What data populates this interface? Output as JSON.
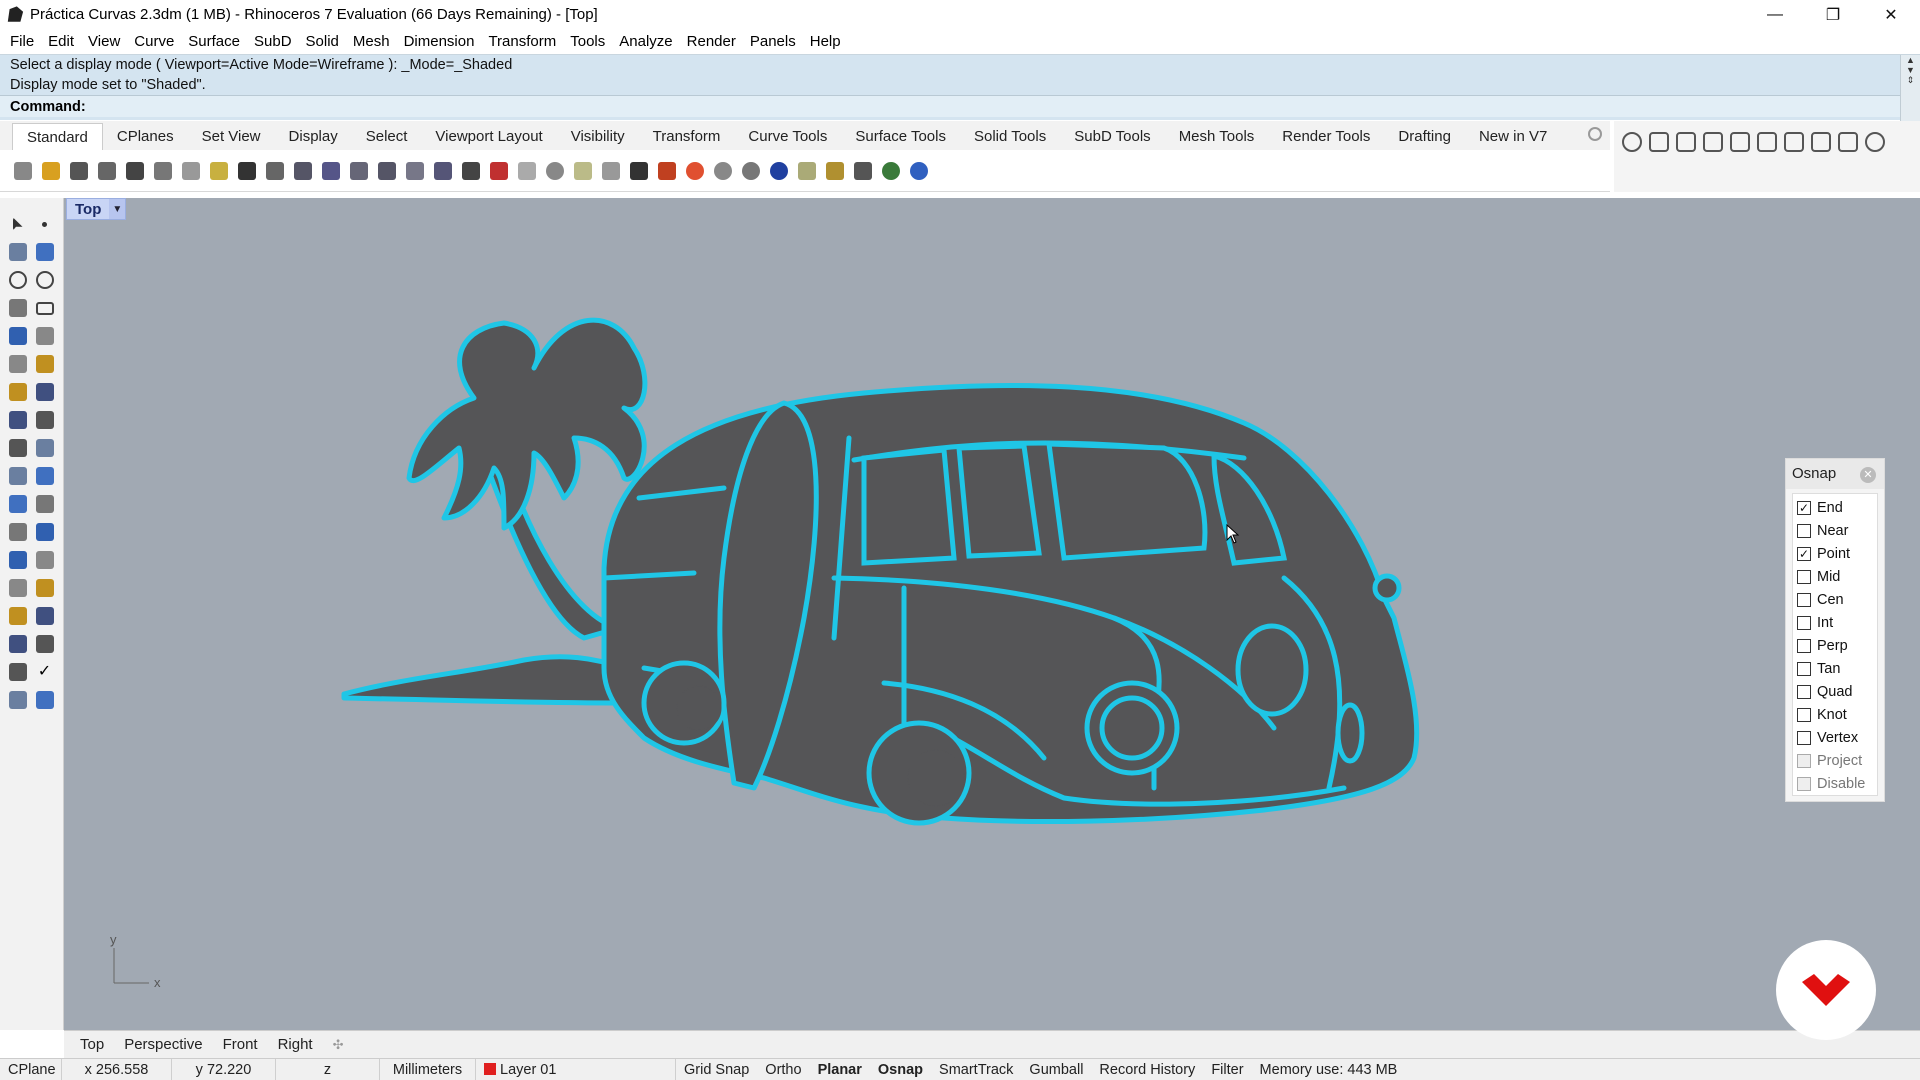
{
  "window": {
    "title": "Práctica Curvas 2.3dm (1 MB) - Rhinoceros 7 Evaluation (66 Days Remaining) - [Top]",
    "minimize": "—",
    "maximize": "❐",
    "close": "✕"
  },
  "menu": [
    "File",
    "Edit",
    "View",
    "Curve",
    "Surface",
    "SubD",
    "Solid",
    "Mesh",
    "Dimension",
    "Transform",
    "Tools",
    "Analyze",
    "Render",
    "Panels",
    "Help"
  ],
  "command": {
    "history": [
      "Select a display mode ( Viewport=Active  Mode=Wireframe ): _Mode=_Shaded",
      "Display mode set to \"Shaded\"."
    ],
    "prompt": "Command:"
  },
  "toolbar_tabs": [
    "Standard",
    "CPlanes",
    "Set View",
    "Display",
    "Select",
    "Viewport Layout",
    "Visibility",
    "Transform",
    "Curve Tools",
    "Surface Tools",
    "Solid Tools",
    "SubD Tools",
    "Mesh Tools",
    "Render Tools",
    "Drafting",
    "New in V7"
  ],
  "toolbar_icons": [
    "new-icon",
    "open-icon",
    "save-icon",
    "print-icon",
    "import-icon",
    "cut-icon",
    "copy-icon",
    "paste-icon",
    "undo-icon",
    "pan-icon",
    "move-view-icon",
    "zoom-in-icon",
    "zoom-window-icon",
    "zoom-extents-icon",
    "zoom-selected-icon",
    "rotate-view-icon",
    "grid-icon",
    "car-icon",
    "light-icon",
    "circle-select-icon",
    "points-icon",
    "bulb-icon",
    "lock-icon",
    "shield-icon",
    "color-wheel-icon",
    "sphere-icon",
    "render-sphere-icon",
    "globe-icon",
    "filter-icon",
    "gears-icon",
    "dim-icon",
    "world-icon",
    "help-icon"
  ],
  "left_tools": [
    [
      "select-arrow-icon",
      "point-icon"
    ],
    [
      "polyline-icon",
      "curve-cv-icon"
    ],
    [
      "circle-icon",
      "ellipse-icon"
    ],
    [
      "polygon-icon",
      "rectangle-icon"
    ],
    [
      "arc-icon",
      "fillet-icon"
    ],
    [
      "surface-icon",
      "loft-icon"
    ],
    [
      "box-icon",
      "solid-icon"
    ],
    [
      "cylinder-icon",
      "mesh-icon"
    ],
    [
      "light-tool-icon",
      "dimension-icon"
    ],
    [
      "hatch-icon",
      "text-icon"
    ],
    [
      "boolean-icon",
      "cluster-icon"
    ],
    [
      "join-icon",
      "explode-icon"
    ],
    [
      "trim-icon",
      "split-icon"
    ],
    [
      "group-icon",
      "ungroup-icon"
    ],
    [
      "block-icon",
      "ruler-icon"
    ],
    [
      "array-icon",
      "distance-icon"
    ],
    [
      "analysis-icon",
      "check-icon"
    ],
    [
      "render-tool-icon",
      "material-icon"
    ]
  ],
  "right_icons": [
    "rhino-icon",
    "box3d-icon",
    "layer-icon",
    "display-icon",
    "filter2-icon",
    "cube-icon",
    "car2-icon",
    "plant-icon",
    "scan-icon",
    "gumball-icon"
  ],
  "viewport": {
    "label": "Top",
    "axis_y": "y",
    "axis_x": "x"
  },
  "osnap": {
    "title": "Osnap",
    "items": [
      {
        "label": "End",
        "checked": true,
        "disabled": false
      },
      {
        "label": "Near",
        "checked": false,
        "disabled": false
      },
      {
        "label": "Point",
        "checked": true,
        "disabled": false
      },
      {
        "label": "Mid",
        "checked": false,
        "disabled": false
      },
      {
        "label": "Cen",
        "checked": false,
        "disabled": false
      },
      {
        "label": "Int",
        "checked": false,
        "disabled": false
      },
      {
        "label": "Perp",
        "checked": false,
        "disabled": false
      },
      {
        "label": "Tan",
        "checked": false,
        "disabled": false
      },
      {
        "label": "Quad",
        "checked": false,
        "disabled": false
      },
      {
        "label": "Knot",
        "checked": false,
        "disabled": false
      },
      {
        "label": "Vertex",
        "checked": false,
        "disabled": false
      },
      {
        "label": "Project",
        "checked": false,
        "disabled": true
      },
      {
        "label": "Disable",
        "checked": false,
        "disabled": true
      }
    ]
  },
  "viewport_tabs": [
    "Top",
    "Perspective",
    "Front",
    "Right",
    "✣"
  ],
  "status": {
    "cplane": "CPlane",
    "x": "x 256.558",
    "y": "y 72.220",
    "z": "z",
    "units": "Millimeters",
    "layer": "Layer 01",
    "toggles": [
      {
        "label": "Grid Snap",
        "active": false
      },
      {
        "label": "Ortho",
        "active": false
      },
      {
        "label": "Planar",
        "active": true
      },
      {
        "label": "Osnap",
        "active": true
      },
      {
        "label": "SmartTrack",
        "active": false
      },
      {
        "label": "Gumball",
        "active": false
      },
      {
        "label": "Record History",
        "active": false
      },
      {
        "label": "Filter",
        "active": false
      }
    ],
    "memory": "Memory use: 443 MB"
  },
  "colors": {
    "viewport_bg": "#a1a9b3",
    "shape_fill": "#555557",
    "highlight": "#1fc6e6",
    "brand_red": "#e01010"
  }
}
